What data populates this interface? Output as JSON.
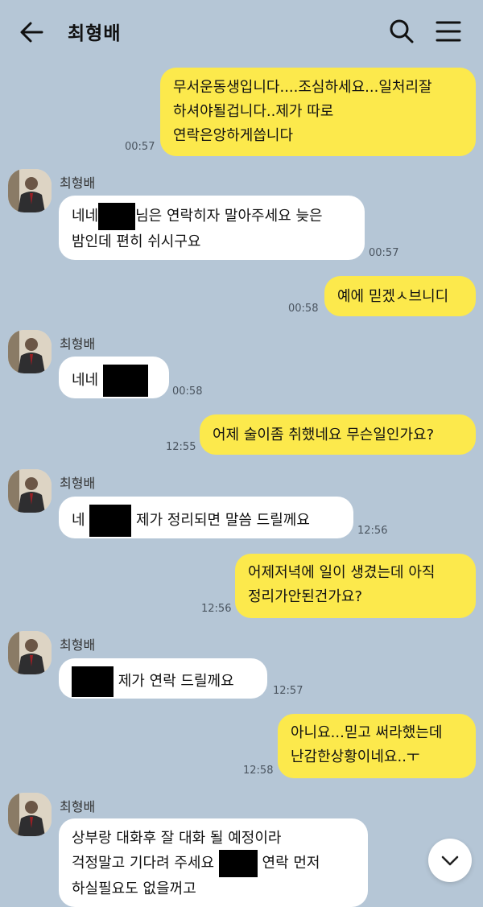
{
  "header": {
    "title": "최형배",
    "back_icon": "arrow-left-icon",
    "search_icon": "search-icon",
    "menu_icon": "hamburger-menu-icon"
  },
  "messages": [
    {
      "direction": "out",
      "lines": [
        "무서운동생입니다....조심하세요...일처리잘",
        "하셔야될겁니다..제가 따로",
        "연락은앙하게씁니다"
      ],
      "time": "00:57"
    },
    {
      "direction": "in",
      "sender": "최형배",
      "lines": [
        "네네",
        "님은 연락히자 말아주세요 늦은",
        "밤인데 편히 쉬시구요"
      ],
      "time": "00:57"
    },
    {
      "direction": "out",
      "lines": [
        "예에 믿겠ㅅ브니디"
      ],
      "time": "00:58"
    },
    {
      "direction": "in",
      "sender": "최형배",
      "lines": [
        "네네"
      ],
      "time": "00:58"
    },
    {
      "direction": "out",
      "lines": [
        "어제 술이좀 취했네요 무슨일인가요?"
      ],
      "time": "12:55"
    },
    {
      "direction": "in",
      "sender": "최형배",
      "lines": [
        "네",
        "제가 정리되면 말씀 드릴께요"
      ],
      "time": "12:56"
    },
    {
      "direction": "out",
      "lines": [
        "어제저녁에 일이 생겼는데 아직",
        "정리가안된건가요?"
      ],
      "time": "12:56"
    },
    {
      "direction": "in",
      "sender": "최형배",
      "lines": [
        "제가 연락 드릴께요"
      ],
      "time": "12:57"
    },
    {
      "direction": "out",
      "lines": [
        "아니요...믿고 써라했는데",
        "난감한상황이네요..ㅜ"
      ],
      "time": "12:58"
    },
    {
      "direction": "in",
      "sender": "최형배",
      "lines": [
        "상부랑 대화후 잘 대화 될 예정이라",
        "걱정말고 기다려 주세요",
        "연락 먼저",
        "하실필요도 없을꺼고"
      ]
    }
  ],
  "scroll_down_icon": "chevron-down-icon",
  "colors": {
    "background": "#b5c6d6",
    "outgoing_bubble": "#fce94c",
    "incoming_bubble": "#ffffff"
  }
}
